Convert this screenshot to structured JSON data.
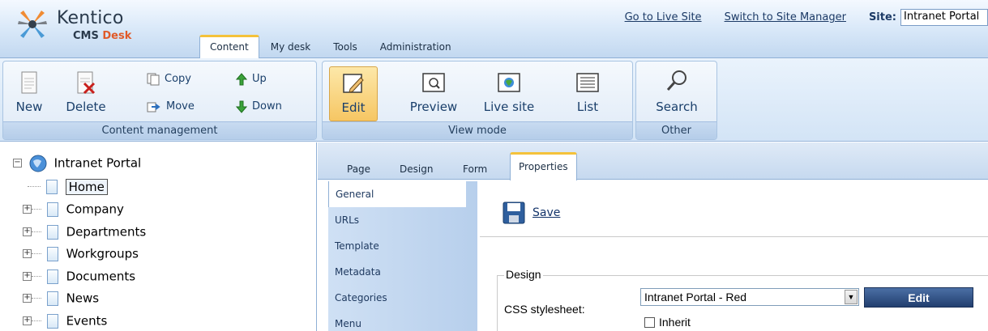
{
  "header": {
    "logo_title": "Kentico",
    "logo_sub_1": "CMS",
    "logo_sub_2": "Desk",
    "links": {
      "live_site": "Go to Live Site",
      "site_manager": "Switch to Site Manager"
    },
    "site_label": "Site:",
    "site_value": "Intranet Portal",
    "tabs": [
      {
        "label": "Content",
        "active": true
      },
      {
        "label": "My desk",
        "active": false
      },
      {
        "label": "Tools",
        "active": false
      },
      {
        "label": "Administration",
        "active": false
      }
    ]
  },
  "ribbon": {
    "content_management": {
      "label": "Content management",
      "new": "New",
      "delete": "Delete",
      "copy": "Copy",
      "move": "Move",
      "up": "Up",
      "down": "Down"
    },
    "view_mode": {
      "label": "View mode",
      "edit": "Edit",
      "preview": "Preview",
      "live_site": "Live site",
      "list": "List",
      "active": "Edit"
    },
    "other": {
      "label": "Other",
      "search": "Search"
    }
  },
  "tree": {
    "root": "Intranet Portal",
    "items": [
      {
        "label": "Home",
        "selected": true
      },
      {
        "label": "Company"
      },
      {
        "label": "Departments"
      },
      {
        "label": "Workgroups"
      },
      {
        "label": "Documents"
      },
      {
        "label": "News"
      },
      {
        "label": "Events"
      }
    ]
  },
  "subtabs": [
    {
      "label": "Page",
      "active": false
    },
    {
      "label": "Design",
      "active": false
    },
    {
      "label": "Form",
      "active": false
    },
    {
      "label": "Properties",
      "active": true
    }
  ],
  "sidenav": [
    {
      "label": "General",
      "active": true
    },
    {
      "label": "URLs"
    },
    {
      "label": "Template"
    },
    {
      "label": "Metadata"
    },
    {
      "label": "Categories"
    },
    {
      "label": "Menu"
    }
  ],
  "form": {
    "save_label": "Save",
    "design_legend": "Design",
    "css_label": "CSS stylesheet:",
    "css_value": "Intranet Portal - Red",
    "edit_button": "Edit",
    "inherit_label": "Inherit",
    "inherit_checked": false
  },
  "colors": {
    "accent_tab": "#f4c23b",
    "link": "#1c3a66",
    "edit_button": "#2d4b7c",
    "active_ribbon": "#f6c663"
  }
}
